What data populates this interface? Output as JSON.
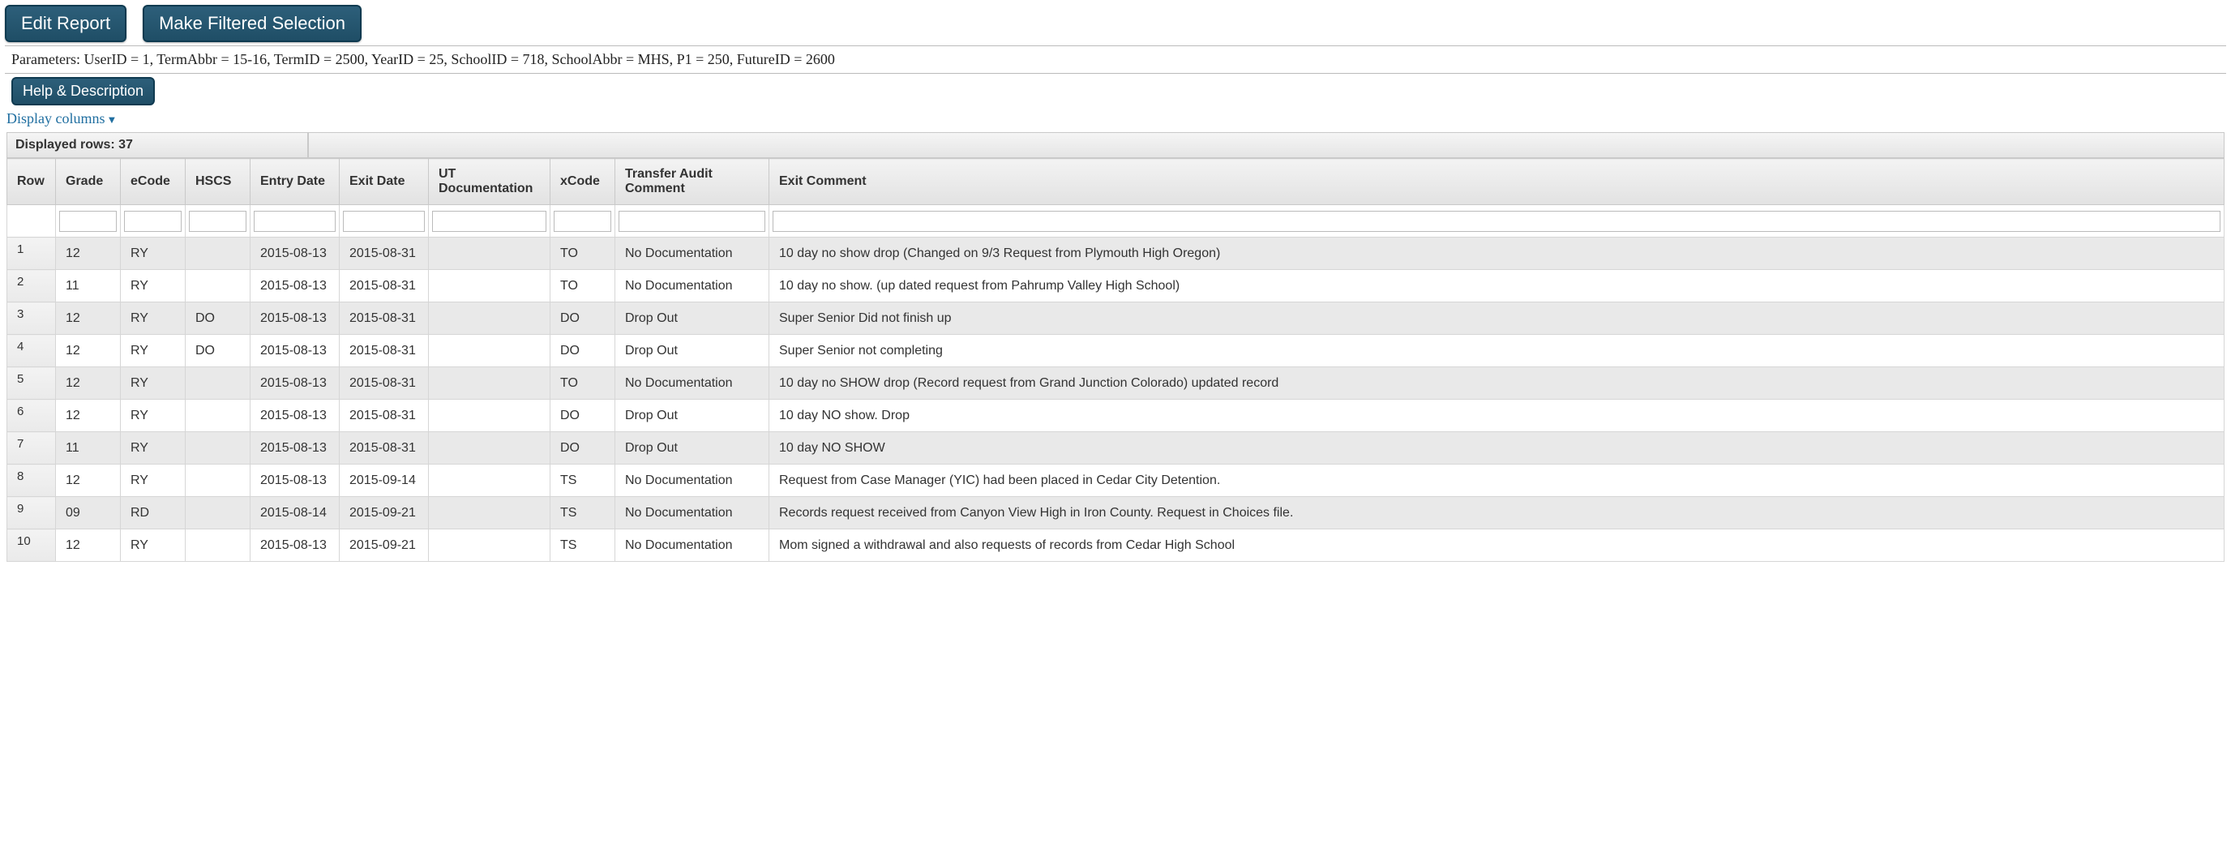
{
  "buttons": {
    "edit_report": "Edit Report",
    "make_filtered": "Make Filtered Selection",
    "help": "Help & Description"
  },
  "parameters_text": "Parameters: UserID = 1, TermAbbr = 15-16, TermID = 2500, YearID = 25, SchoolID = 718, SchoolAbbr = MHS, P1 = 250, FutureID = 2600",
  "display_columns_label": "Display columns",
  "displayed_rows_label": "Displayed rows: 37",
  "columns": {
    "row": "Row",
    "grade": "Grade",
    "ecode": "eCode",
    "hscs": "HSCS",
    "entry_date": "Entry Date",
    "exit_date": "Exit Date",
    "ut_doc": "UT Documentation",
    "xcode": "xCode",
    "audit": "Transfer Audit Comment",
    "exit_comment": "Exit Comment"
  },
  "rows": [
    {
      "n": "1",
      "grade": "12",
      "ecode": "RY",
      "hscs": "",
      "entry": "2015-08-13",
      "exit": "2015-08-31",
      "utdoc": "",
      "xcode": "TO",
      "audit": "No Documentation",
      "exitc": "10 day no show drop (Changed on 9/3 Request from Plymouth High Oregon)"
    },
    {
      "n": "2",
      "grade": "11",
      "ecode": "RY",
      "hscs": "",
      "entry": "2015-08-13",
      "exit": "2015-08-31",
      "utdoc": "",
      "xcode": "TO",
      "audit": "No Documentation",
      "exitc": "10 day no show. (up dated request from Pahrump Valley High School)"
    },
    {
      "n": "3",
      "grade": "12",
      "ecode": "RY",
      "hscs": "DO",
      "entry": "2015-08-13",
      "exit": "2015-08-31",
      "utdoc": "",
      "xcode": "DO",
      "audit": "Drop Out",
      "exitc": "Super Senior Did not finish up"
    },
    {
      "n": "4",
      "grade": "12",
      "ecode": "RY",
      "hscs": "DO",
      "entry": "2015-08-13",
      "exit": "2015-08-31",
      "utdoc": "",
      "xcode": "DO",
      "audit": "Drop Out",
      "exitc": "Super Senior not completing"
    },
    {
      "n": "5",
      "grade": "12",
      "ecode": "RY",
      "hscs": "",
      "entry": "2015-08-13",
      "exit": "2015-08-31",
      "utdoc": "",
      "xcode": "TO",
      "audit": "No Documentation",
      "exitc": "10 day no SHOW drop (Record request from Grand Junction Colorado) updated record"
    },
    {
      "n": "6",
      "grade": "12",
      "ecode": "RY",
      "hscs": "",
      "entry": "2015-08-13",
      "exit": "2015-08-31",
      "utdoc": "",
      "xcode": "DO",
      "audit": "Drop Out",
      "exitc": "10 day NO show. Drop"
    },
    {
      "n": "7",
      "grade": "11",
      "ecode": "RY",
      "hscs": "",
      "entry": "2015-08-13",
      "exit": "2015-08-31",
      "utdoc": "",
      "xcode": "DO",
      "audit": "Drop Out",
      "exitc": "10 day NO SHOW"
    },
    {
      "n": "8",
      "grade": "12",
      "ecode": "RY",
      "hscs": "",
      "entry": "2015-08-13",
      "exit": "2015-09-14",
      "utdoc": "",
      "xcode": "TS",
      "audit": "No Documentation",
      "exitc": "Request from Case Manager (YIC) had been placed in Cedar City Detention."
    },
    {
      "n": "9",
      "grade": "09",
      "ecode": "RD",
      "hscs": "",
      "entry": "2015-08-14",
      "exit": "2015-09-21",
      "utdoc": "",
      "xcode": "TS",
      "audit": "No Documentation",
      "exitc": "Records request received from Canyon View High in Iron County. Request in Choices file."
    },
    {
      "n": "10",
      "grade": "12",
      "ecode": "RY",
      "hscs": "",
      "entry": "2015-08-13",
      "exit": "2015-09-21",
      "utdoc": "",
      "xcode": "TS",
      "audit": "No Documentation",
      "exitc": "Mom signed a withdrawal and also requests of records from Cedar High School"
    }
  ]
}
